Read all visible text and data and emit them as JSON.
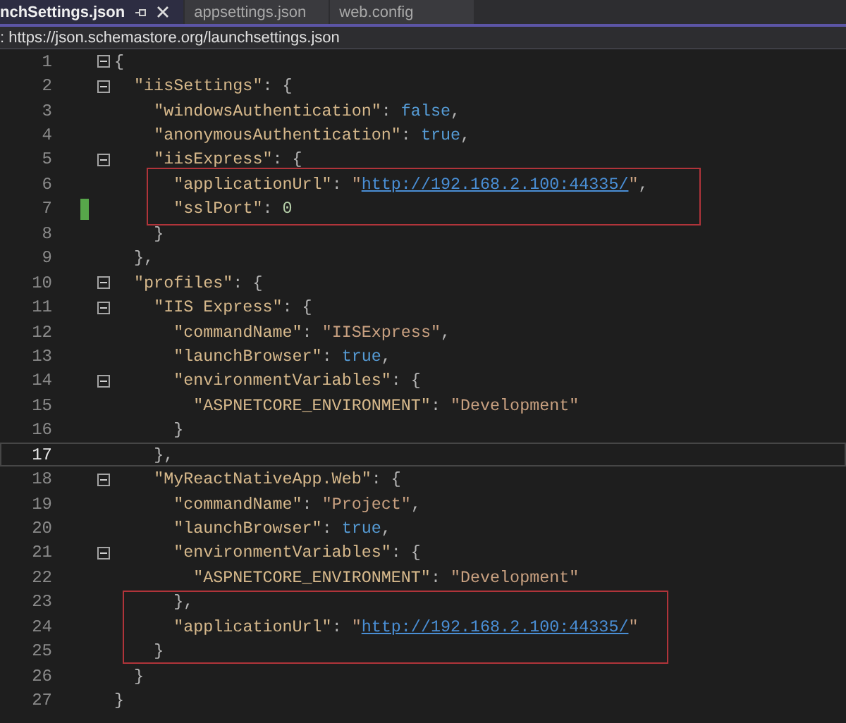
{
  "tabs": [
    {
      "label": "nchSettings.json",
      "selected": true,
      "pinned": true
    },
    {
      "label": "appsettings.json",
      "selected": false,
      "pinned": false
    },
    {
      "label": "web.config",
      "selected": false,
      "pinned": false
    }
  ],
  "schema_bar": {
    "text": ": https://json.schemastore.org/launchsettings.json"
  },
  "editor": {
    "lines": [
      {
        "number": "1",
        "expanded": true,
        "changed": false,
        "selected": false,
        "tokens": [
          {
            "kind": "punct",
            "text": "{"
          }
        ]
      },
      {
        "number": "2",
        "expanded": true,
        "changed": false,
        "selected": false,
        "tokens": [
          {
            "kind": "key",
            "text": "  \"iisSettings\""
          },
          {
            "kind": "punct",
            "text": ": {"
          }
        ]
      },
      {
        "number": "3",
        "changed": false,
        "selected": false,
        "tokens": [
          {
            "kind": "key",
            "text": "    \"windowsAuthentication\""
          },
          {
            "kind": "punct",
            "text": ": "
          },
          {
            "kind": "keyword",
            "text": "false"
          },
          {
            "kind": "punct",
            "text": ","
          }
        ]
      },
      {
        "number": "4",
        "changed": false,
        "selected": false,
        "tokens": [
          {
            "kind": "key",
            "text": "    \"anonymousAuthentication\""
          },
          {
            "kind": "punct",
            "text": ": "
          },
          {
            "kind": "keyword",
            "text": "true"
          },
          {
            "kind": "punct",
            "text": ","
          }
        ]
      },
      {
        "number": "5",
        "expanded": true,
        "changed": false,
        "selected": false,
        "tokens": [
          {
            "kind": "key",
            "text": "    \"iisExpress\""
          },
          {
            "kind": "punct",
            "text": ": {"
          }
        ]
      },
      {
        "number": "6",
        "changed": false,
        "selected": false,
        "tokens": [
          {
            "kind": "key",
            "text": "      \"applicationUrl\""
          },
          {
            "kind": "punct",
            "text": ": "
          },
          {
            "kind": "string",
            "text": "\""
          },
          {
            "kind": "link",
            "text": "http://192.168.2.100:44335/"
          },
          {
            "kind": "string",
            "text": "\""
          },
          {
            "kind": "punct",
            "text": ","
          }
        ]
      },
      {
        "number": "7",
        "changed": true,
        "selected": false,
        "tokens": [
          {
            "kind": "key",
            "text": "      \"sslPort\""
          },
          {
            "kind": "punct",
            "text": ": "
          },
          {
            "kind": "number",
            "text": "0"
          }
        ]
      },
      {
        "number": "8",
        "changed": false,
        "selected": false,
        "tokens": [
          {
            "kind": "punct",
            "text": "    }"
          }
        ]
      },
      {
        "number": "9",
        "changed": false,
        "selected": false,
        "tokens": [
          {
            "kind": "punct",
            "text": "  },"
          }
        ]
      },
      {
        "number": "10",
        "expanded": true,
        "changed": false,
        "selected": false,
        "tokens": [
          {
            "kind": "key",
            "text": "  \"profiles\""
          },
          {
            "kind": "punct",
            "text": ": {"
          }
        ]
      },
      {
        "number": "11",
        "expanded": true,
        "changed": false,
        "selected": false,
        "tokens": [
          {
            "kind": "key",
            "text": "    \"IIS Express\""
          },
          {
            "kind": "punct",
            "text": ": {"
          }
        ]
      },
      {
        "number": "12",
        "changed": false,
        "selected": false,
        "tokens": [
          {
            "kind": "key",
            "text": "      \"commandName\""
          },
          {
            "kind": "punct",
            "text": ": "
          },
          {
            "kind": "string",
            "text": "\"IISExpress\""
          },
          {
            "kind": "punct",
            "text": ","
          }
        ]
      },
      {
        "number": "13",
        "changed": false,
        "selected": false,
        "tokens": [
          {
            "kind": "key",
            "text": "      \"launchBrowser\""
          },
          {
            "kind": "punct",
            "text": ": "
          },
          {
            "kind": "keyword",
            "text": "true"
          },
          {
            "kind": "punct",
            "text": ","
          }
        ]
      },
      {
        "number": "14",
        "expanded": true,
        "changed": false,
        "selected": false,
        "tokens": [
          {
            "kind": "key",
            "text": "      \"environmentVariables\""
          },
          {
            "kind": "punct",
            "text": ": {"
          }
        ]
      },
      {
        "number": "15",
        "changed": false,
        "selected": false,
        "tokens": [
          {
            "kind": "key",
            "text": "        \"ASPNETCORE_ENVIRONMENT\""
          },
          {
            "kind": "punct",
            "text": ": "
          },
          {
            "kind": "string",
            "text": "\"Development\""
          }
        ]
      },
      {
        "number": "16",
        "changed": false,
        "selected": false,
        "tokens": [
          {
            "kind": "punct",
            "text": "      }"
          }
        ]
      },
      {
        "number": "17",
        "changed": false,
        "selected": true,
        "tokens": [
          {
            "kind": "punct",
            "text": "    },"
          }
        ]
      },
      {
        "number": "18",
        "expanded": true,
        "changed": false,
        "selected": false,
        "tokens": [
          {
            "kind": "key",
            "text": "    \"MyReactNativeApp.Web\""
          },
          {
            "kind": "punct",
            "text": ": {"
          }
        ]
      },
      {
        "number": "19",
        "changed": false,
        "selected": false,
        "tokens": [
          {
            "kind": "key",
            "text": "      \"commandName\""
          },
          {
            "kind": "punct",
            "text": ": "
          },
          {
            "kind": "string",
            "text": "\"Project\""
          },
          {
            "kind": "punct",
            "text": ","
          }
        ]
      },
      {
        "number": "20",
        "changed": false,
        "selected": false,
        "tokens": [
          {
            "kind": "key",
            "text": "      \"launchBrowser\""
          },
          {
            "kind": "punct",
            "text": ": "
          },
          {
            "kind": "keyword",
            "text": "true"
          },
          {
            "kind": "punct",
            "text": ","
          }
        ]
      },
      {
        "number": "21",
        "expanded": true,
        "changed": false,
        "selected": false,
        "tokens": [
          {
            "kind": "key",
            "text": "      \"environmentVariables\""
          },
          {
            "kind": "punct",
            "text": ": {"
          }
        ]
      },
      {
        "number": "22",
        "changed": false,
        "selected": false,
        "tokens": [
          {
            "kind": "key",
            "text": "        \"ASPNETCORE_ENVIRONMENT\""
          },
          {
            "kind": "punct",
            "text": ": "
          },
          {
            "kind": "string",
            "text": "\"Development\""
          }
        ]
      },
      {
        "number": "23",
        "changed": false,
        "selected": false,
        "tokens": [
          {
            "kind": "punct",
            "text": "      },"
          }
        ]
      },
      {
        "number": "24",
        "changed": false,
        "selected": false,
        "tokens": [
          {
            "kind": "key",
            "text": "      \"applicationUrl\""
          },
          {
            "kind": "punct",
            "text": ": "
          },
          {
            "kind": "string",
            "text": "\""
          },
          {
            "kind": "link",
            "text": "http://192.168.2.100:44335/"
          },
          {
            "kind": "string",
            "text": "\""
          }
        ]
      },
      {
        "number": "25",
        "changed": false,
        "selected": false,
        "tokens": [
          {
            "kind": "punct",
            "text": "    }"
          }
        ]
      },
      {
        "number": "26",
        "changed": false,
        "selected": false,
        "tokens": [
          {
            "kind": "punct",
            "text": "  }"
          }
        ]
      },
      {
        "number": "27",
        "changed": false,
        "selected": false,
        "tokens": [
          {
            "kind": "punct",
            "text": "}"
          }
        ]
      }
    ]
  }
}
